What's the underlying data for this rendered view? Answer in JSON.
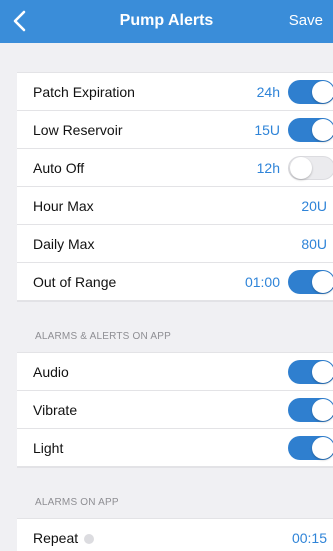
{
  "header": {
    "title": "Pump Alerts",
    "save_label": "Save"
  },
  "colors": {
    "nav_bar": "#3a8dd9",
    "accent": "#2f84d8",
    "toggle_on": "#2f7fcf",
    "toggle_off": "#ebebee"
  },
  "pump_settings": [
    {
      "label": "Patch Expiration",
      "value": "24h",
      "toggle": "on"
    },
    {
      "label": "Low Reservoir",
      "value": "15U",
      "toggle": "on"
    },
    {
      "label": "Auto Off",
      "value": "12h",
      "toggle": "off"
    },
    {
      "label": "Hour Max",
      "value": "20U"
    },
    {
      "label": "Daily Max",
      "value": "80U"
    },
    {
      "label": "Out of Range",
      "value": "01:00",
      "toggle": "on"
    }
  ],
  "alarms_alerts_section": {
    "heading": "ALARMS & ALERTS ON APP",
    "items": [
      {
        "label": "Audio",
        "toggle": "on"
      },
      {
        "label": "Vibrate",
        "toggle": "on"
      },
      {
        "label": "Light",
        "toggle": "on"
      }
    ]
  },
  "alarms_section": {
    "heading": "ALARMS ON APP",
    "items": [
      {
        "label": "Repeat",
        "value": "00:15",
        "icon": "info-icon"
      }
    ]
  }
}
